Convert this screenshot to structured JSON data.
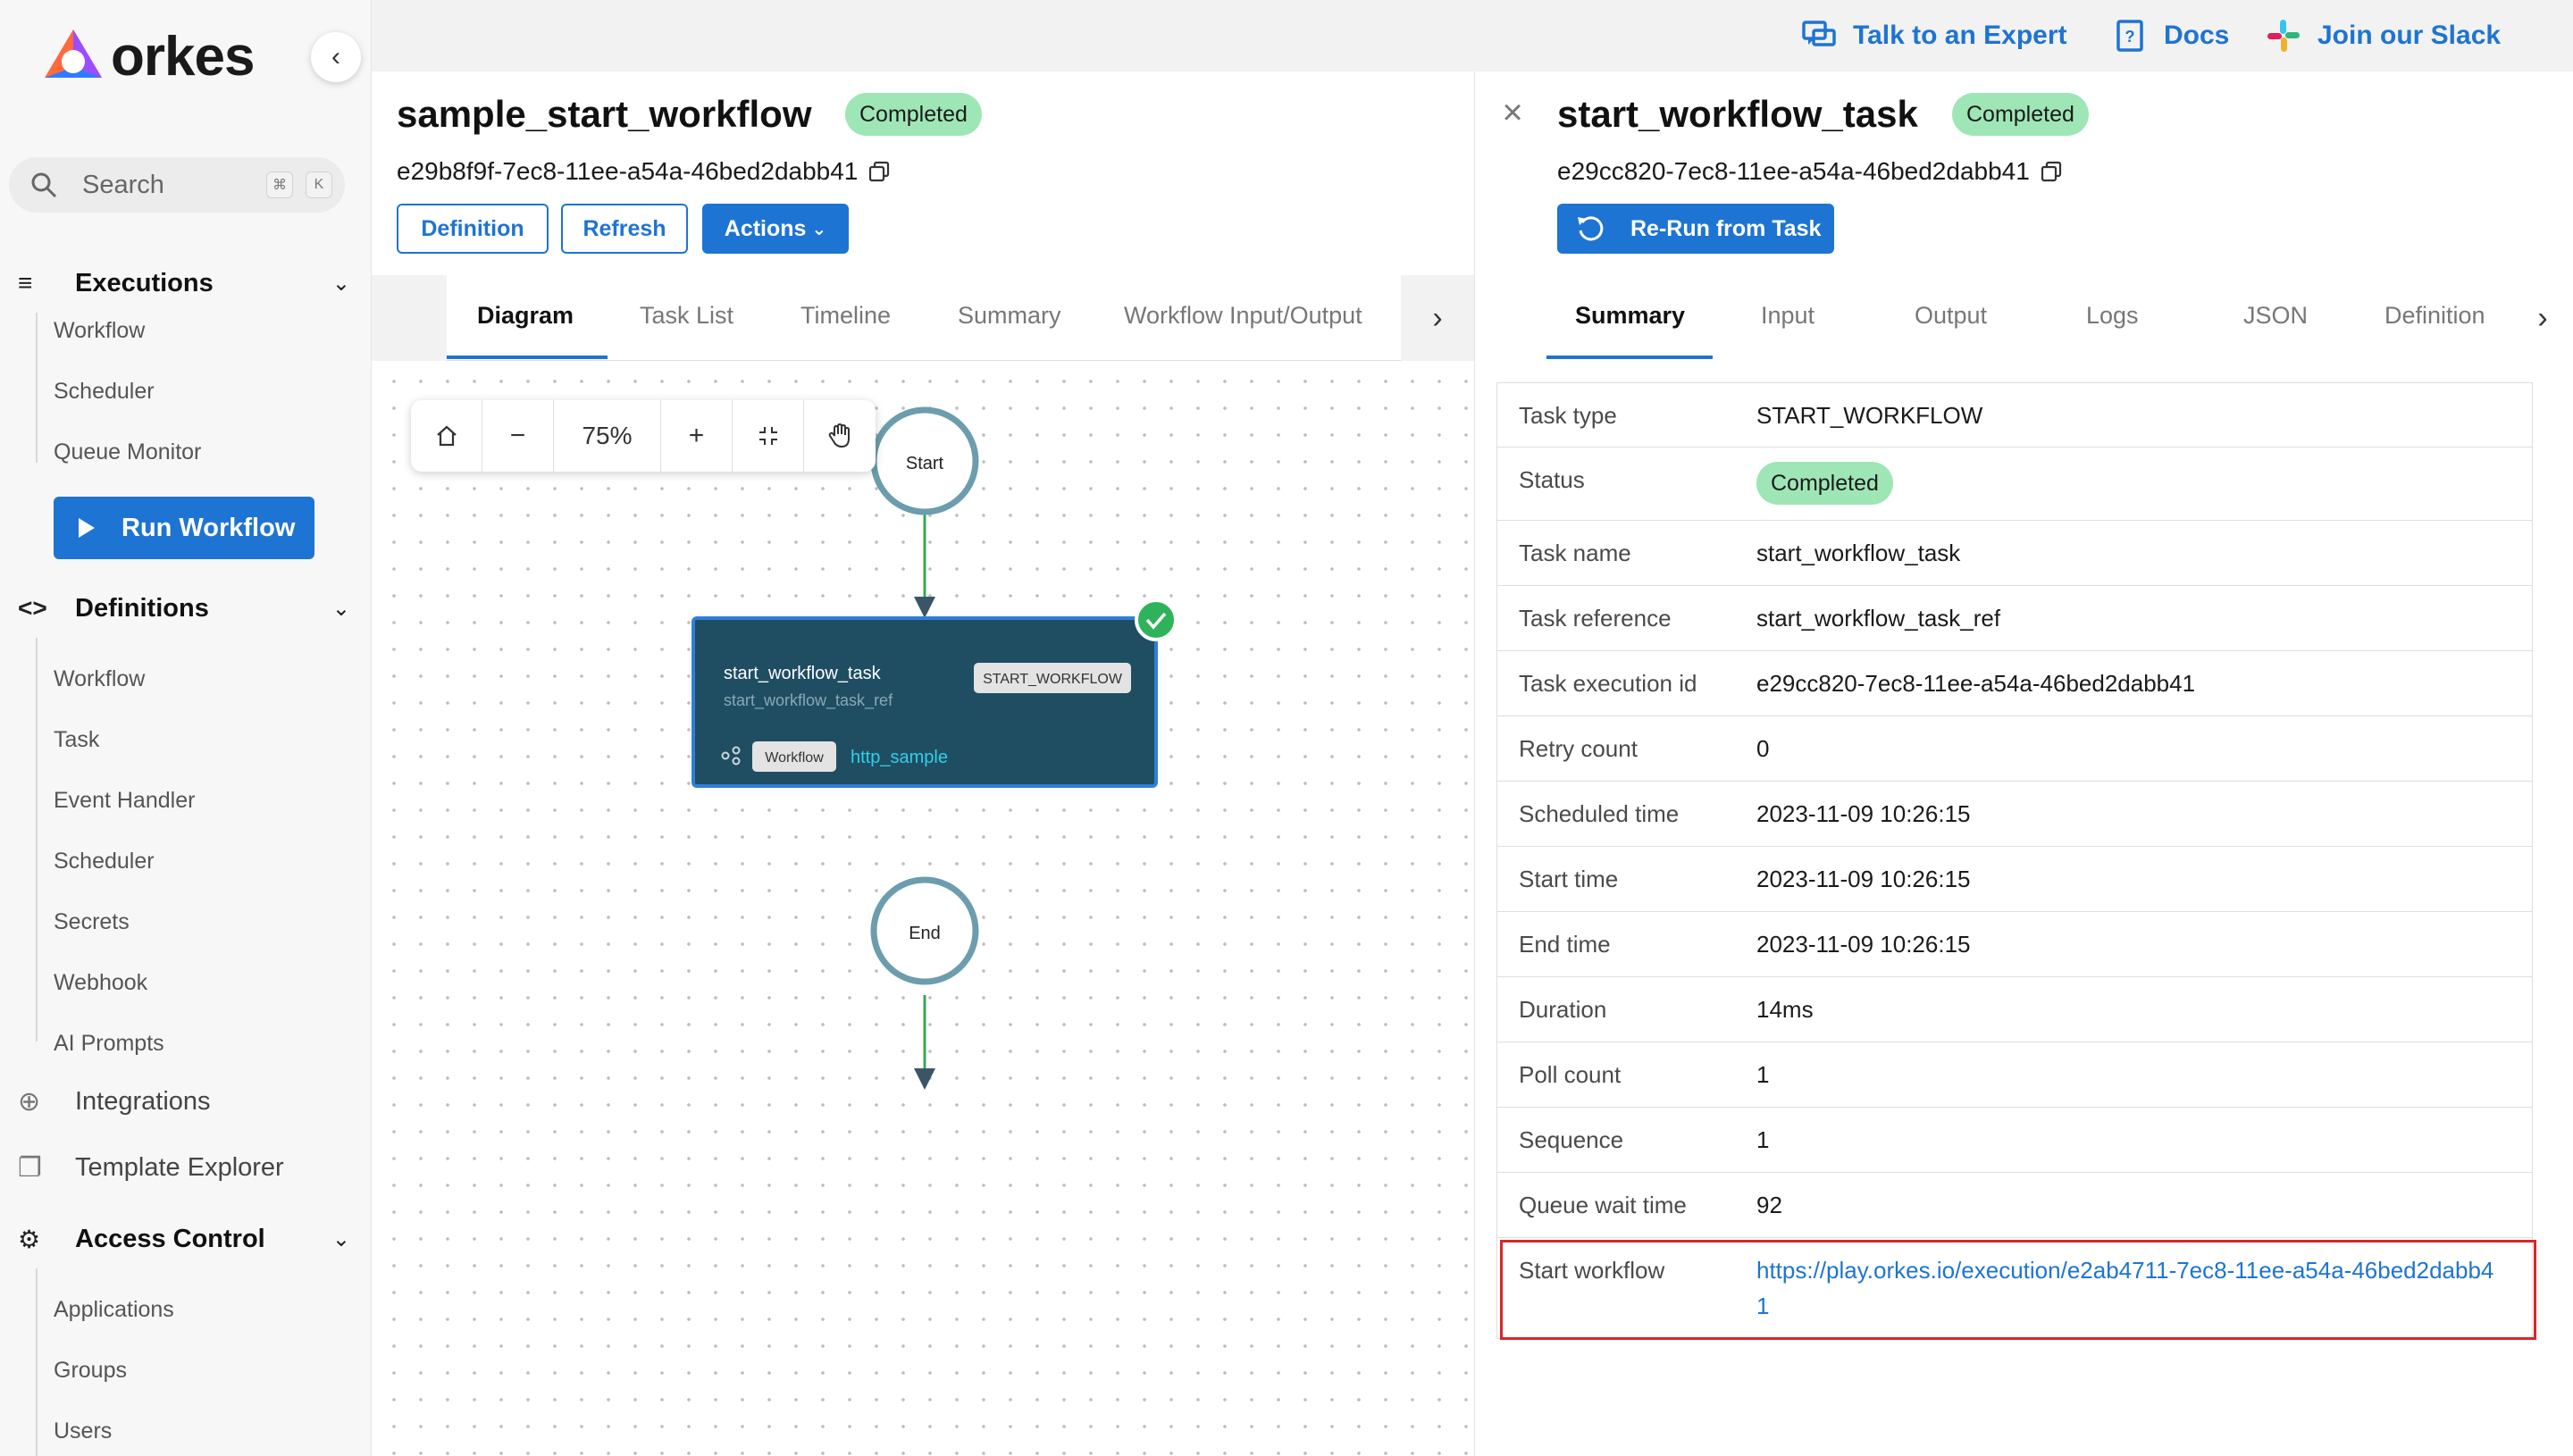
{
  "brand": {
    "logo_text": "orkes"
  },
  "topbar": {
    "talk_expert": "Talk to an Expert",
    "docs": "Docs",
    "join_slack": "Join our Slack"
  },
  "sidebar": {
    "search": {
      "label": "Search",
      "kbd1": "⌘",
      "kbd2": "K"
    },
    "executions": {
      "label": "Executions",
      "items": [
        "Workflow",
        "Scheduler",
        "Queue Monitor"
      ]
    },
    "run_workflow": "Run Workflow",
    "definitions": {
      "label": "Definitions",
      "items": [
        "Workflow",
        "Task",
        "Event Handler",
        "Scheduler",
        "Secrets",
        "Webhook",
        "AI Prompts"
      ]
    },
    "integrations": "Integrations",
    "template_explorer": "Template Explorer",
    "access_control": {
      "label": "Access Control",
      "items": [
        "Applications",
        "Groups",
        "Users"
      ]
    }
  },
  "workflow": {
    "title": "sample_start_workflow",
    "status": "Completed",
    "id": "e29b8f9f-7ec8-11ee-a54a-46bed2dabb41",
    "buttons": {
      "definition": "Definition",
      "refresh": "Refresh",
      "actions": "Actions"
    },
    "tabs": [
      "Diagram",
      "Task List",
      "Timeline",
      "Summary",
      "Workflow Input/Output"
    ],
    "active_tab": "Diagram"
  },
  "canvas": {
    "zoom": "75%",
    "start_label": "Start",
    "end_label": "End",
    "task_node": {
      "name": "start_workflow_task",
      "ref": "start_workflow_task_ref",
      "type": "START_WORKFLOW",
      "sub_tag": "Workflow",
      "sub_link": "http_sample"
    }
  },
  "task_panel": {
    "title": "start_workflow_task",
    "status": "Completed",
    "id": "e29cc820-7ec8-11ee-a54a-46bed2dabb41",
    "rerun": "Re-Run from Task",
    "tabs": [
      "Summary",
      "Input",
      "Output",
      "Logs",
      "JSON",
      "Definition"
    ],
    "active_tab": "Summary",
    "rows": [
      {
        "key": "Task type",
        "value": "START_WORKFLOW"
      },
      {
        "key": "Status",
        "value": "Completed"
      },
      {
        "key": "Task name",
        "value": "start_workflow_task"
      },
      {
        "key": "Task reference",
        "value": "start_workflow_task_ref"
      },
      {
        "key": "Task execution id",
        "value": "e29cc820-7ec8-11ee-a54a-46bed2dabb41"
      },
      {
        "key": "Retry count",
        "value": "0"
      },
      {
        "key": "Scheduled time",
        "value": "2023-11-09 10:26:15"
      },
      {
        "key": "Start time",
        "value": "2023-11-09 10:26:15"
      },
      {
        "key": "End time",
        "value": "2023-11-09 10:26:15"
      },
      {
        "key": "Duration",
        "value": "14ms"
      },
      {
        "key": "Poll count",
        "value": "1"
      },
      {
        "key": "Sequence",
        "value": "1"
      },
      {
        "key": "Queue wait time",
        "value": "92"
      },
      {
        "key": "Start workflow",
        "value": "https://play.orkes.io/execution/e2ab4711-7ec8-11ee-a54a-46bed2dabb41"
      }
    ]
  },
  "colors": {
    "primary": "#1e74d2",
    "success": "#9ee6b6",
    "node": "#1f4e63",
    "highlight": "#d9262a"
  }
}
